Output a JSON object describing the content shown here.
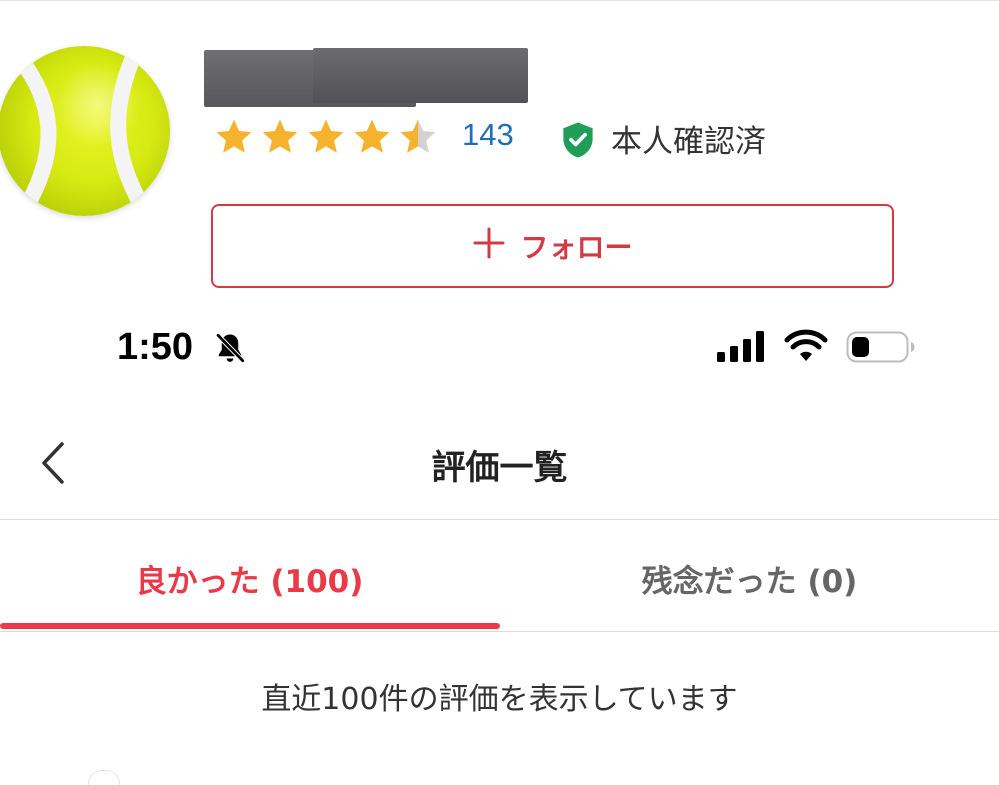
{
  "profile": {
    "rating_count": "143",
    "verified_label": "本人確認済",
    "follow_label": "フォロー",
    "rating_stars": 4.5,
    "avatar_icon": "tennis-ball-icon"
  },
  "status_bar": {
    "time": "1:50"
  },
  "nav": {
    "title": "評価一覧"
  },
  "tabs": [
    {
      "label": "良かった (100)",
      "active": true
    },
    {
      "label": "残念だった (0)",
      "active": false
    }
  ],
  "info": {
    "text": "直近100件の評価を表示しています"
  },
  "colors": {
    "accent": "#ea3a48",
    "star": "#f6b12d",
    "link": "#1e6fb8",
    "verified": "#1f9e57"
  }
}
